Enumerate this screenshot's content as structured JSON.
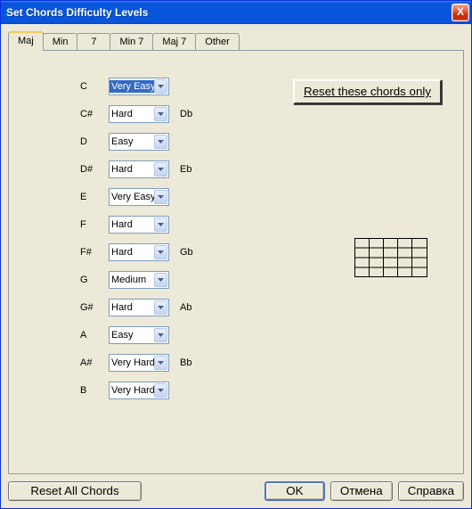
{
  "window": {
    "title": "Set Chords Difficulty Levels"
  },
  "tabs": [
    {
      "label": "Maj",
      "active": true
    },
    {
      "label": "Min",
      "active": false
    },
    {
      "label": "7",
      "active": false
    },
    {
      "label": "Min 7",
      "active": false
    },
    {
      "label": "Maj 7",
      "active": false
    },
    {
      "label": "Other",
      "active": false
    }
  ],
  "chords": [
    {
      "note": "C",
      "difficulty": "Very Easy",
      "alt": "",
      "selected": true
    },
    {
      "note": "C#",
      "difficulty": "Hard",
      "alt": "Db",
      "selected": false
    },
    {
      "note": "D",
      "difficulty": "Easy",
      "alt": "",
      "selected": false
    },
    {
      "note": "D#",
      "difficulty": "Hard",
      "alt": "Eb",
      "selected": false
    },
    {
      "note": "E",
      "difficulty": "Very Easy",
      "alt": "",
      "selected": false
    },
    {
      "note": "F",
      "difficulty": "Hard",
      "alt": "",
      "selected": false
    },
    {
      "note": "F#",
      "difficulty": "Hard",
      "alt": "Gb",
      "selected": false
    },
    {
      "note": "G",
      "difficulty": "Medium",
      "alt": "",
      "selected": false
    },
    {
      "note": "G#",
      "difficulty": "Hard",
      "alt": "Ab",
      "selected": false
    },
    {
      "note": "A",
      "difficulty": "Easy",
      "alt": "",
      "selected": false
    },
    {
      "note": "A#",
      "difficulty": "Very Hard",
      "alt": "Bb",
      "selected": false
    },
    {
      "note": "B",
      "difficulty": "Very Hard",
      "alt": "",
      "selected": false
    }
  ],
  "buttons": {
    "reset_these": "Reset these chords only",
    "reset_all": "Reset All Chords",
    "ok": "OK",
    "cancel": "Отмена",
    "help": "Справка"
  },
  "icons": {
    "close": "X"
  }
}
